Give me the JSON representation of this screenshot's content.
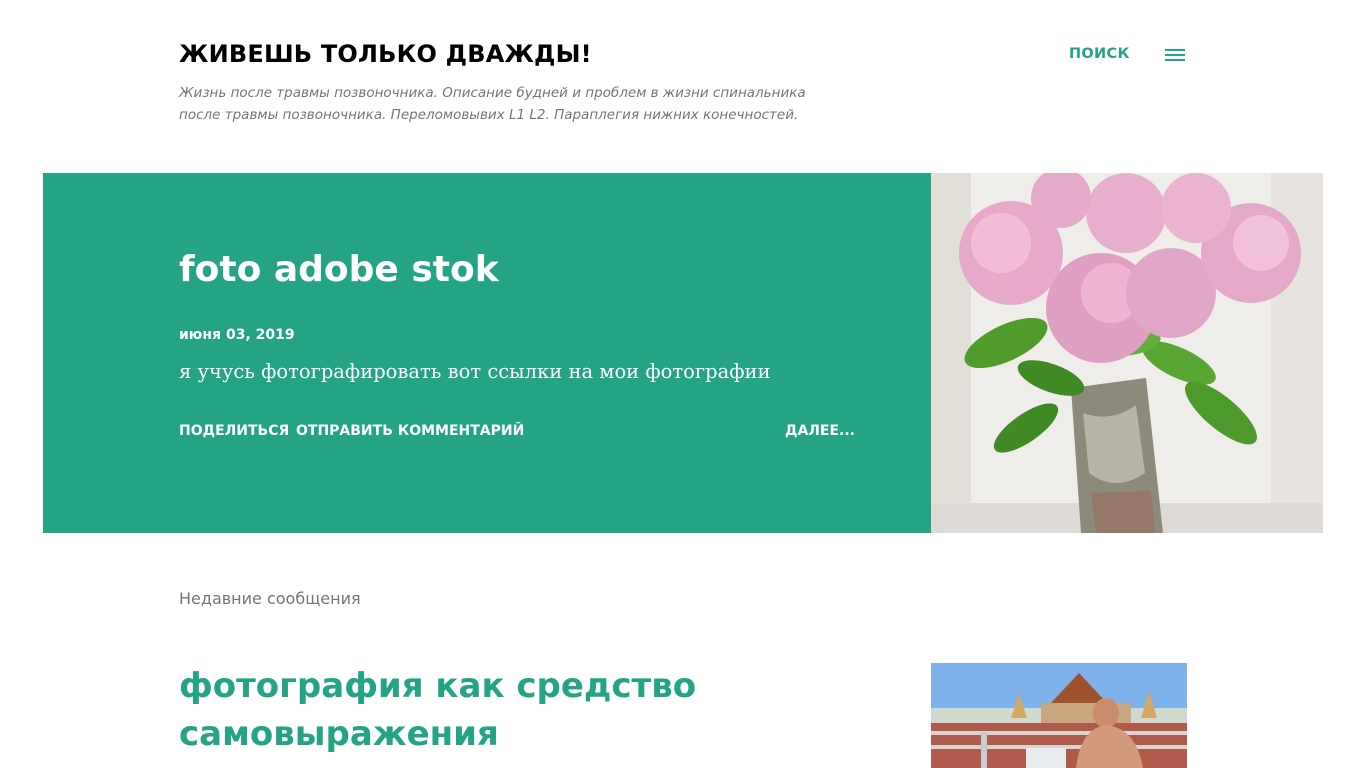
{
  "header": {
    "title": "ЖИВЕШЬ ТОЛЬКО ДВАЖДЫ!",
    "description": "Жизнь после травмы позвоночника. Описание будней и проблем в жизни спинальника после травмы позвоночника. Переломовывих L1 L2. Параплегия нижних конечностей.",
    "search_label": "ПОИСК",
    "menu_icon": "hamburger-menu-icon"
  },
  "featured": {
    "title": "foto adobe stok",
    "date": "июня 03, 2019",
    "snippet": "я учусь фотографировать вот ссылки на мои фотографии",
    "share_label": "ПОДЕЛИТЬСЯ",
    "comment_label": "ОТПРАВИТЬ КОММЕНТАРИЙ",
    "more_label": "ДАЛЕЕ...",
    "background_color": "#24a385",
    "image": "pink-hydrangea-vase-photo"
  },
  "recent": {
    "label": "Недавние сообщения",
    "post_title": "фотография как средство самовыражения",
    "image": "man-at-pool-photo"
  },
  "colors": {
    "accent": "#24a385",
    "title": "#000000",
    "muted": "#757575"
  }
}
